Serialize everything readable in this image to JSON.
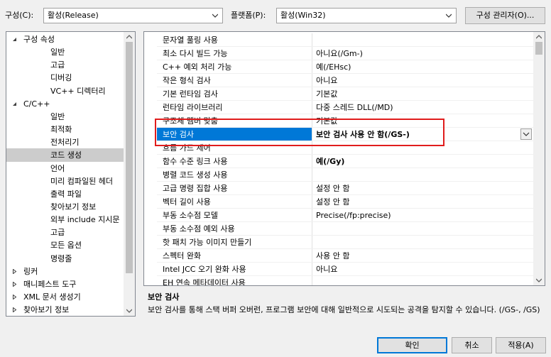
{
  "toolbar": {
    "config_label": "구성(C):",
    "config_value": "활성(Release)",
    "platform_label": "플랫폼(P):",
    "platform_value": "활성(Win32)",
    "config_manager_button": "구성 관리자(O)..."
  },
  "tree": [
    {
      "label": "구성 속성",
      "expander": "open"
    },
    {
      "label": "일반"
    },
    {
      "label": "고급"
    },
    {
      "label": "디버깅"
    },
    {
      "label": "VC++ 디렉터리"
    },
    {
      "label": "C/C++",
      "expander": "open"
    },
    {
      "label": "일반"
    },
    {
      "label": "최적화"
    },
    {
      "label": "전처리기"
    },
    {
      "label": "코드 생성",
      "selected": true
    },
    {
      "label": "언어"
    },
    {
      "label": "미리 컴파일된 헤더"
    },
    {
      "label": "출력 파일"
    },
    {
      "label": "찾아보기 정보"
    },
    {
      "label": "외부 include 지시문"
    },
    {
      "label": "고급"
    },
    {
      "label": "모든 옵션"
    },
    {
      "label": "명령줄"
    },
    {
      "label": "링커",
      "expander": "closed"
    },
    {
      "label": "매니페스트 도구",
      "expander": "closed"
    },
    {
      "label": "XML 문서 생성기",
      "expander": "closed"
    },
    {
      "label": "찾아보기 정보",
      "expander": "closed"
    }
  ],
  "properties": [
    {
      "name": "문자열 풀링 사용",
      "value": ""
    },
    {
      "name": "최소 다시 빌드 가능",
      "value": "아니요(/Gm-)"
    },
    {
      "name": "C++ 예외 처리 가능",
      "value": "예(/EHsc)"
    },
    {
      "name": "작은 형식 검사",
      "value": "아니요"
    },
    {
      "name": "기본 런타임 검사",
      "value": "기본값"
    },
    {
      "name": "런타임 라이브러리",
      "value": "다중 스레드 DLL(/MD)"
    },
    {
      "name": "구조체 멤버 맞춤",
      "value": "기본값"
    },
    {
      "name": "보안 검사",
      "value": "보안 검사 사용 안 함(/GS-)",
      "selected": true
    },
    {
      "name": "흐름 가드 제어",
      "value": ""
    },
    {
      "name": "함수 수준 링크 사용",
      "value": "예(/Gy)",
      "bold": true
    },
    {
      "name": "병렬 코드 생성 사용",
      "value": ""
    },
    {
      "name": "고급 명령 집합 사용",
      "value": "설정 안 함"
    },
    {
      "name": "벡터 길이 사용",
      "value": "설정 안 함"
    },
    {
      "name": "부동 소수점 모델",
      "value": "Precise(/fp:precise)"
    },
    {
      "name": "부동 소수점 예외 사용",
      "value": ""
    },
    {
      "name": "핫 패치 가능 이미지 만들기",
      "value": ""
    },
    {
      "name": "스펙터 완화",
      "value": "사용 안 함"
    },
    {
      "name": "Intel JCC 오기 완화 사용",
      "value": "아니요"
    },
    {
      "name": "EH 연속 메타데이터 사용",
      "value": ""
    }
  ],
  "description": {
    "title": "보안 검사",
    "body": "보안 검사를 통해 스택 버퍼 오버런, 프로그램 보안에 대해 일반적으로 시도되는 공격을 탐지할 수 있습니다. (/GS-, /GS)"
  },
  "buttons": {
    "ok": "확인",
    "cancel": "취소",
    "apply": "적용(A)"
  },
  "colors": {
    "selection_blue": "#0078d7",
    "highlight_red": "#e01c1c",
    "tree_selection": "#cccccc"
  }
}
